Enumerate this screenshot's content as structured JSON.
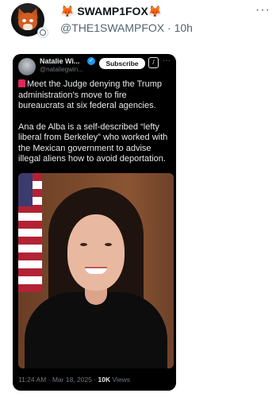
{
  "post": {
    "display_name": "🦊 SWAMP1FOX🦊",
    "handle": "@THE1SWAMPFOX",
    "time": "10h",
    "more_icon": "more-horizontal-icon"
  },
  "embedded": {
    "author_name": "Natalie Wi...",
    "author_handle": "@nataliegwin...",
    "subscribe_label": "Subscribe",
    "grok_icon": "grok-icon",
    "paragraph1": "Meet the Judge denying the Trump administration's move to fire bureaucrats at six federal agencies.",
    "paragraph2": "Ana de Alba is a self-described “lefty liberal from Berkeley” who worked with the Mexican government to advise illegal aliens how to avoid deportation.",
    "timestamp": "11:24 AM · Mar 18, 2025 · ",
    "views_count": "10K",
    "views_label": " Views"
  }
}
